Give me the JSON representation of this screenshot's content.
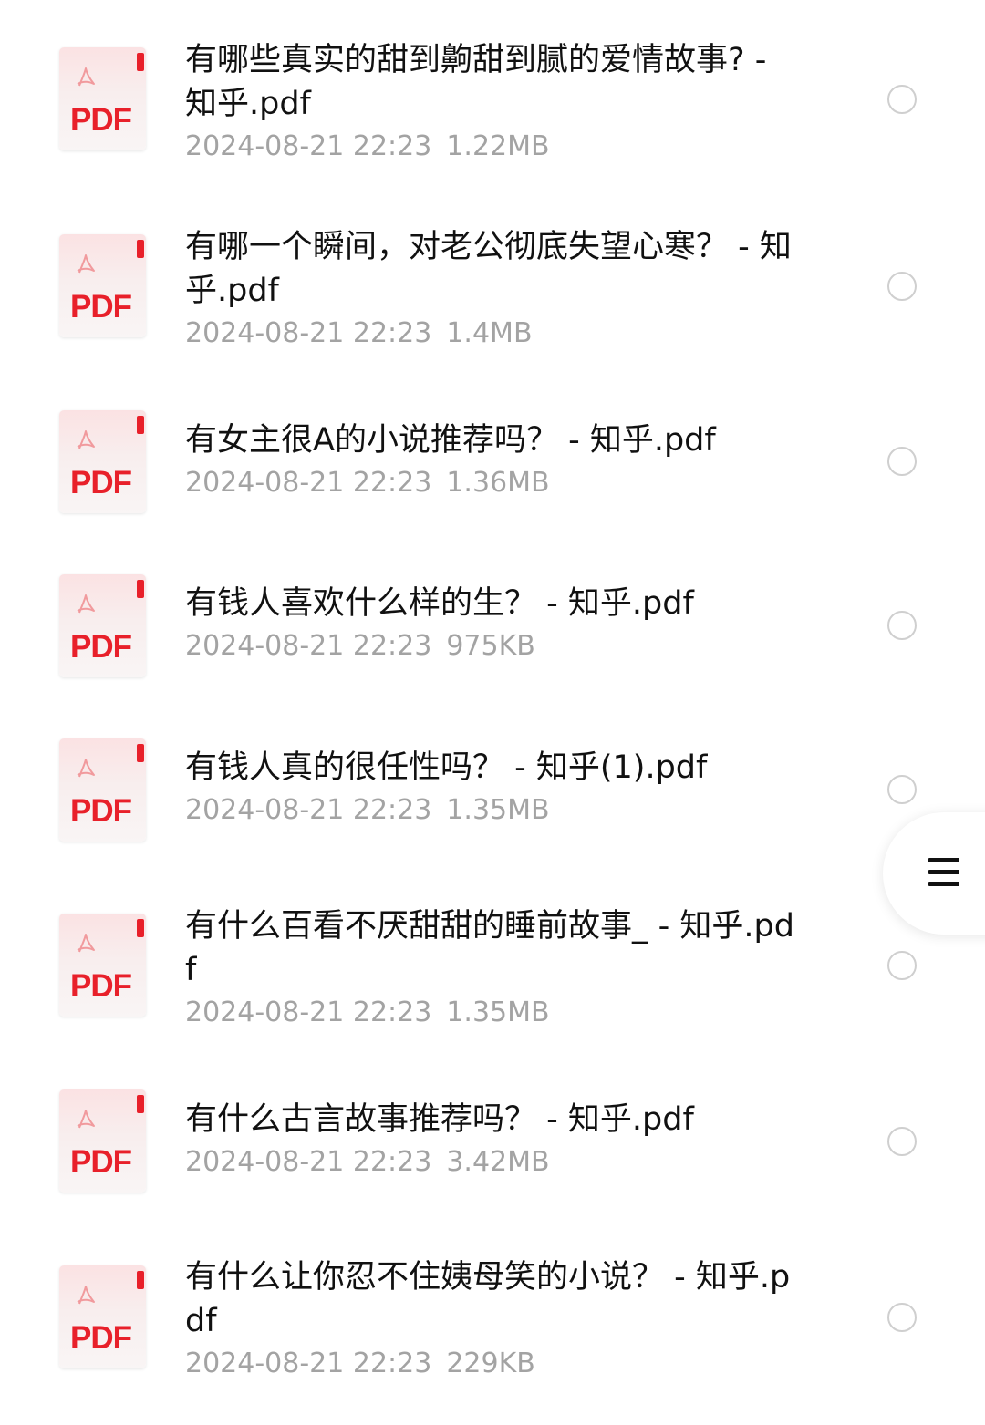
{
  "files": [
    {
      "name": "有哪些真实的甜到齁甜到腻的爱情故事? - 知乎.pdf",
      "date": "2024-08-21 22:23",
      "size": "1.22MB",
      "icon": "pdf-file-icon"
    },
    {
      "name": "有哪一个瞬间，对老公彻底失望心寒？ - 知乎.pdf",
      "date": "2024-08-21 22:23",
      "size": "1.4MB",
      "icon": "pdf-file-icon"
    },
    {
      "name": "有女主很A的小说推荐吗？ - 知乎.pdf",
      "date": "2024-08-21 22:23",
      "size": "1.36MB",
      "icon": "pdf-file-icon"
    },
    {
      "name": "有钱人喜欢什么样的生？ - 知乎.pdf",
      "date": "2024-08-21 22:23",
      "size": "975KB",
      "icon": "pdf-file-icon"
    },
    {
      "name": "有钱人真的很任性吗？ - 知乎(1).pdf",
      "date": "2024-08-21 22:23",
      "size": "1.35MB",
      "icon": "pdf-file-icon"
    },
    {
      "name": "有什么百看不厌甜甜的睡前故事_ - 知乎.pdf",
      "date": "2024-08-21 22:23",
      "size": "1.35MB",
      "icon": "pdf-file-icon"
    },
    {
      "name": "有什么古言故事推荐吗？ - 知乎.pdf",
      "date": "2024-08-21 22:23",
      "size": "3.42MB",
      "icon": "pdf-file-icon"
    },
    {
      "name": "有什么让你忍不住姨母笑的小说？ - 知乎.pdf",
      "date": "2024-08-21 22:23",
      "size": "229KB",
      "icon": "pdf-file-icon"
    }
  ],
  "pdf_icon_label": "PDF",
  "menu_icon": "hamburger-menu-icon",
  "colors": {
    "pdf_red": "#e8202a",
    "meta_gray": "#a3a3a3",
    "radio_border": "#cfcfcf"
  }
}
